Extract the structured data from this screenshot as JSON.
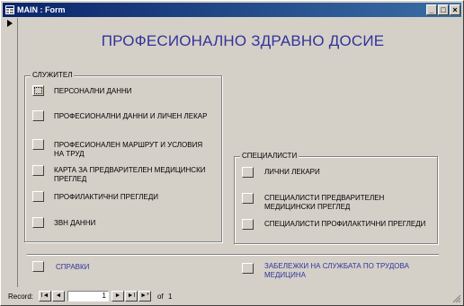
{
  "window": {
    "title": "MAIN : Form",
    "minimize_label": "_",
    "maximize_label": "□",
    "close_label": "×"
  },
  "form": {
    "heading": "ПРОФЕСИОНАЛНО ЗДРАВНО ДОСИЕ",
    "employee_group": {
      "label": "СЛУЖИТЕЛ",
      "items": [
        "ПЕРСОНАЛНИ ДАННИ",
        "ПРОФЕСИОНАЛНИ ДАННИ И ЛИЧЕН ЛЕКАР",
        "ПРОФЕСИОНАЛЕН МАРШРУТ И УСЛОВИЯ НА ТРУД",
        "КАРТА ЗА ПРЕДВАРИТЕЛЕН МЕДИЦИНСКИ ПРЕГЛЕД",
        "ПРОФИЛАКТИЧНИ ПРЕГЛЕДИ",
        "ЗВН ДАННИ"
      ]
    },
    "specialists_group": {
      "label": "СПЕЦИАЛИСТИ",
      "items": [
        "ЛИЧНИ ЛЕКАРИ",
        "СПЕЦИАЛИСТИ  ПРЕДВАРИТЕЛЕН МЕДИЦИНСКИ ПРЕГЛЕД",
        "СПЕЦИАЛИСТИ ПРОФИЛАКТИЧНИ ПРЕГЛЕДИ"
      ]
    },
    "footer": {
      "reports": "СПРАВКИ",
      "notes": "ЗАБЕЛЕЖКИ НА СЛУЖБАТА ПО ТРУДОВА МЕДИЦИНА"
    }
  },
  "navigation": {
    "record_label": "Record:",
    "current": "1",
    "of_label": "of",
    "total": "1",
    "first": "I◄",
    "prev": "◄",
    "next": "►",
    "last": "►I",
    "new": "►*"
  }
}
